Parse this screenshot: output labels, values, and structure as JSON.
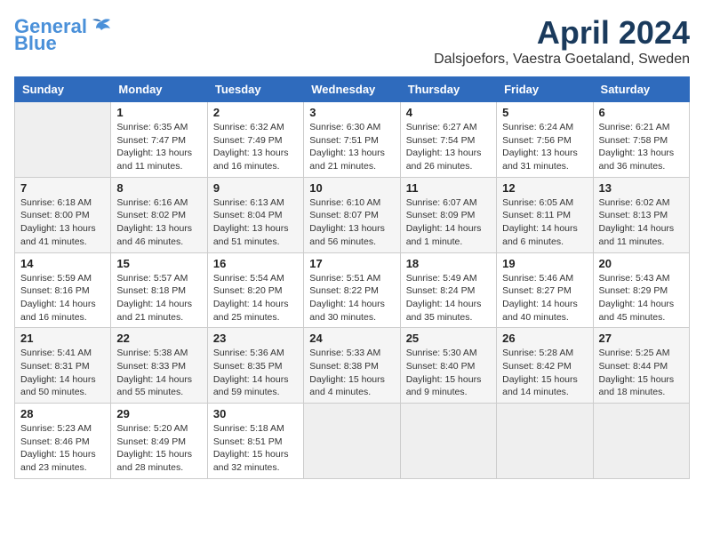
{
  "header": {
    "logo_line1": "General",
    "logo_line2": "Blue",
    "month": "April 2024",
    "location": "Dalsjoefors, Vaestra Goetaland, Sweden"
  },
  "weekdays": [
    "Sunday",
    "Monday",
    "Tuesday",
    "Wednesday",
    "Thursday",
    "Friday",
    "Saturday"
  ],
  "weeks": [
    [
      {
        "day": "",
        "info": ""
      },
      {
        "day": "1",
        "info": "Sunrise: 6:35 AM\nSunset: 7:47 PM\nDaylight: 13 hours\nand 11 minutes."
      },
      {
        "day": "2",
        "info": "Sunrise: 6:32 AM\nSunset: 7:49 PM\nDaylight: 13 hours\nand 16 minutes."
      },
      {
        "day": "3",
        "info": "Sunrise: 6:30 AM\nSunset: 7:51 PM\nDaylight: 13 hours\nand 21 minutes."
      },
      {
        "day": "4",
        "info": "Sunrise: 6:27 AM\nSunset: 7:54 PM\nDaylight: 13 hours\nand 26 minutes."
      },
      {
        "day": "5",
        "info": "Sunrise: 6:24 AM\nSunset: 7:56 PM\nDaylight: 13 hours\nand 31 minutes."
      },
      {
        "day": "6",
        "info": "Sunrise: 6:21 AM\nSunset: 7:58 PM\nDaylight: 13 hours\nand 36 minutes."
      }
    ],
    [
      {
        "day": "7",
        "info": "Sunrise: 6:18 AM\nSunset: 8:00 PM\nDaylight: 13 hours\nand 41 minutes."
      },
      {
        "day": "8",
        "info": "Sunrise: 6:16 AM\nSunset: 8:02 PM\nDaylight: 13 hours\nand 46 minutes."
      },
      {
        "day": "9",
        "info": "Sunrise: 6:13 AM\nSunset: 8:04 PM\nDaylight: 13 hours\nand 51 minutes."
      },
      {
        "day": "10",
        "info": "Sunrise: 6:10 AM\nSunset: 8:07 PM\nDaylight: 13 hours\nand 56 minutes."
      },
      {
        "day": "11",
        "info": "Sunrise: 6:07 AM\nSunset: 8:09 PM\nDaylight: 14 hours\nand 1 minute."
      },
      {
        "day": "12",
        "info": "Sunrise: 6:05 AM\nSunset: 8:11 PM\nDaylight: 14 hours\nand 6 minutes."
      },
      {
        "day": "13",
        "info": "Sunrise: 6:02 AM\nSunset: 8:13 PM\nDaylight: 14 hours\nand 11 minutes."
      }
    ],
    [
      {
        "day": "14",
        "info": "Sunrise: 5:59 AM\nSunset: 8:16 PM\nDaylight: 14 hours\nand 16 minutes."
      },
      {
        "day": "15",
        "info": "Sunrise: 5:57 AM\nSunset: 8:18 PM\nDaylight: 14 hours\nand 21 minutes."
      },
      {
        "day": "16",
        "info": "Sunrise: 5:54 AM\nSunset: 8:20 PM\nDaylight: 14 hours\nand 25 minutes."
      },
      {
        "day": "17",
        "info": "Sunrise: 5:51 AM\nSunset: 8:22 PM\nDaylight: 14 hours\nand 30 minutes."
      },
      {
        "day": "18",
        "info": "Sunrise: 5:49 AM\nSunset: 8:24 PM\nDaylight: 14 hours\nand 35 minutes."
      },
      {
        "day": "19",
        "info": "Sunrise: 5:46 AM\nSunset: 8:27 PM\nDaylight: 14 hours\nand 40 minutes."
      },
      {
        "day": "20",
        "info": "Sunrise: 5:43 AM\nSunset: 8:29 PM\nDaylight: 14 hours\nand 45 minutes."
      }
    ],
    [
      {
        "day": "21",
        "info": "Sunrise: 5:41 AM\nSunset: 8:31 PM\nDaylight: 14 hours\nand 50 minutes."
      },
      {
        "day": "22",
        "info": "Sunrise: 5:38 AM\nSunset: 8:33 PM\nDaylight: 14 hours\nand 55 minutes."
      },
      {
        "day": "23",
        "info": "Sunrise: 5:36 AM\nSunset: 8:35 PM\nDaylight: 14 hours\nand 59 minutes."
      },
      {
        "day": "24",
        "info": "Sunrise: 5:33 AM\nSunset: 8:38 PM\nDaylight: 15 hours\nand 4 minutes."
      },
      {
        "day": "25",
        "info": "Sunrise: 5:30 AM\nSunset: 8:40 PM\nDaylight: 15 hours\nand 9 minutes."
      },
      {
        "day": "26",
        "info": "Sunrise: 5:28 AM\nSunset: 8:42 PM\nDaylight: 15 hours\nand 14 minutes."
      },
      {
        "day": "27",
        "info": "Sunrise: 5:25 AM\nSunset: 8:44 PM\nDaylight: 15 hours\nand 18 minutes."
      }
    ],
    [
      {
        "day": "28",
        "info": "Sunrise: 5:23 AM\nSunset: 8:46 PM\nDaylight: 15 hours\nand 23 minutes."
      },
      {
        "day": "29",
        "info": "Sunrise: 5:20 AM\nSunset: 8:49 PM\nDaylight: 15 hours\nand 28 minutes."
      },
      {
        "day": "30",
        "info": "Sunrise: 5:18 AM\nSunset: 8:51 PM\nDaylight: 15 hours\nand 32 minutes."
      },
      {
        "day": "",
        "info": ""
      },
      {
        "day": "",
        "info": ""
      },
      {
        "day": "",
        "info": ""
      },
      {
        "day": "",
        "info": ""
      }
    ]
  ]
}
